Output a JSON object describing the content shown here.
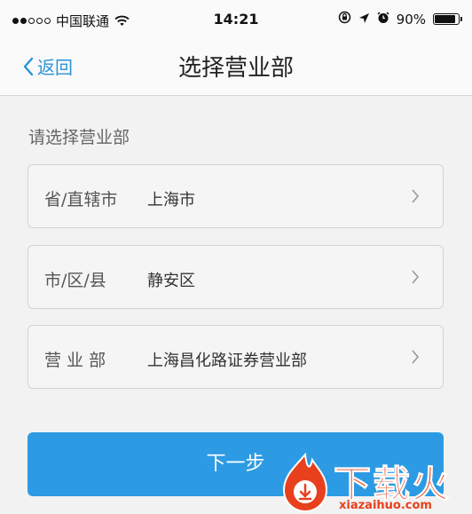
{
  "status_bar": {
    "carrier": "中国联通",
    "time": "14:21",
    "battery": "90%",
    "battery_level": 0.9
  },
  "nav": {
    "back_label": "返回",
    "title": "选择营业部"
  },
  "form": {
    "section_label": "请选择营业部",
    "rows": [
      {
        "label": "省/直辖市",
        "value": "上海市"
      },
      {
        "label": "市/区/县",
        "value": "静安区"
      },
      {
        "label": "营 业 部",
        "value": "上海昌化路证券营业部"
      }
    ]
  },
  "actions": {
    "next_label": "下一步"
  },
  "watermark": {
    "text": "下载火",
    "url": "xiazaihuo.com"
  },
  "colors": {
    "accent": "#2d9be3",
    "link": "#2a93d6",
    "watermark": "#e8401c"
  },
  "icons": [
    "wifi-icon",
    "orientation-lock-icon",
    "location-arrow-icon",
    "alarm-icon",
    "battery-icon",
    "back-chevron-icon",
    "chevron-right-icon",
    "flame-logo-icon"
  ]
}
